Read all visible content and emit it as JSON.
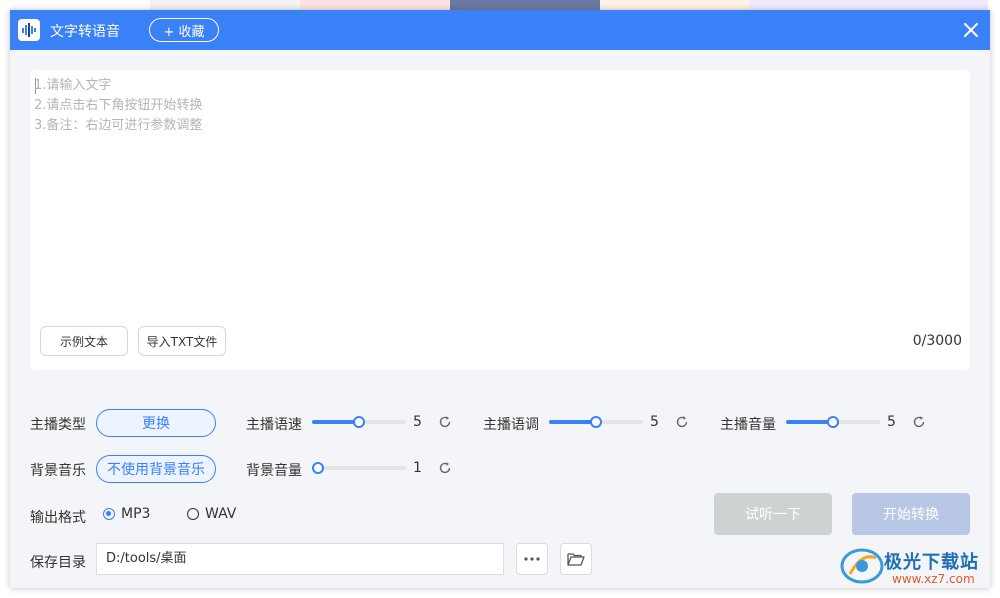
{
  "app": {
    "title": "文字转语音",
    "favorite_label": "+ 收藏"
  },
  "editor": {
    "placeholder_lines": [
      "1.请输入文字",
      "2.请点击右下角按钮开始转换",
      "3.备注：右边可进行参数调整"
    ],
    "example_button": "示例文本",
    "import_button": "导入TXT文件",
    "counter": "0/3000"
  },
  "settings": {
    "anchor_type": {
      "label": "主播类型",
      "button": "更换"
    },
    "speed": {
      "label": "主播语速",
      "value": "5",
      "level": 0.5
    },
    "pitch": {
      "label": "主播语调",
      "value": "5",
      "level": 0.5
    },
    "volume": {
      "label": "主播音量",
      "value": "5",
      "level": 0.5
    },
    "bg_music": {
      "label": "背景音乐",
      "button": "不使用背景音乐"
    },
    "bg_volume": {
      "label": "背景音量",
      "value": "1",
      "level": 0.0
    },
    "output_format": {
      "label": "输出格式",
      "options": [
        "MP3",
        "WAV"
      ],
      "selected": "MP3"
    },
    "save_dir": {
      "label": "保存目录",
      "value": "D:/tools/桌面"
    }
  },
  "actions": {
    "preview": "试听一下",
    "start": "开始转换"
  },
  "watermark": {
    "name": "极光下载站",
    "url": "www.xz7.com"
  },
  "colors": {
    "accent": "#3a80f7",
    "preview_disabled": "#ccd3d0",
    "start_disabled": "#b8c7e6",
    "panel": "#f3f5f9"
  },
  "icons": {
    "app": "waveform-icon",
    "close": "close-icon",
    "reset": "refresh-icon",
    "more": "ellipsis-icon",
    "folder": "folder-icon"
  }
}
